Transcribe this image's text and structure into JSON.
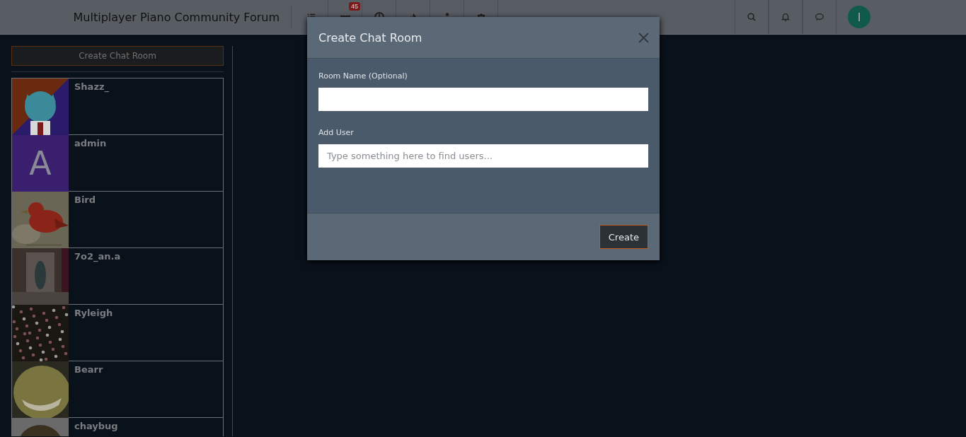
{
  "header": {
    "title": "Multiplayer Piano Community Forum",
    "nav_badge": "45",
    "user_initial": "I"
  },
  "sidebar": {
    "create_button": "Create Chat Room",
    "users": [
      {
        "name": "Shazz_"
      },
      {
        "name": "admin",
        "avatar": {
          "kind": "letter",
          "letter": "A",
          "color": "#3a1f6e"
        }
      },
      {
        "name": "Bird"
      },
      {
        "name": "7o2_an.a"
      },
      {
        "name": "Ryleigh"
      },
      {
        "name": "Bearr"
      },
      {
        "name": "chaybug"
      }
    ]
  },
  "modal": {
    "title": "Create Chat Room",
    "fields": [
      {
        "label": "Room Name (Optional)"
      },
      {
        "label": "Add User",
        "placeholder": "Type something here to find users..."
      }
    ],
    "button": "Create"
  }
}
